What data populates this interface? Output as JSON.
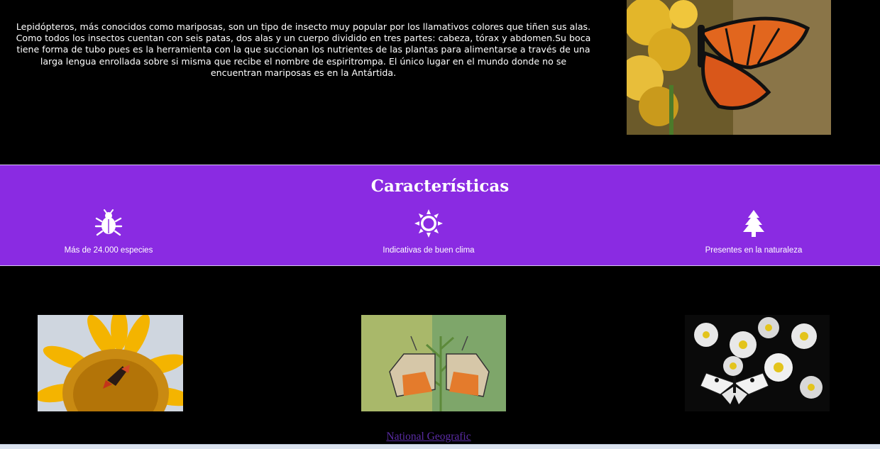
{
  "intro": {
    "text": "Lepidópteros, más conocidos como mariposas, son un tipo de insecto muy popular por los llamativos colores que tiñen sus alas. Como todos los insectos cuentan con seis patas, dos alas y un cuerpo dividido en tres partes: cabeza, tórax y abdomen.Su boca tiene forma de tubo pues es la herramienta con la que succionan los nutrientes de las plantas para alimentarse a través de una larga lengua enrollada sobre si misma que recibe el nombre de espiritrompa. El único lugar en el mundo donde no se encuentran mariposas es en la Antártida."
  },
  "features": {
    "title": "Características",
    "items": [
      {
        "icon": "bug-icon",
        "label": "Más de 24.000 especies"
      },
      {
        "icon": "sun-icon",
        "label": "Indicativas de buen clima"
      },
      {
        "icon": "tree-icon",
        "label": "Presentes en la naturaleza"
      }
    ]
  },
  "gallery": {
    "images": [
      {
        "subject": "butterfly on sunflower"
      },
      {
        "subject": "two butterflies on a stem"
      },
      {
        "subject": "butterfly on daisies"
      }
    ]
  },
  "footer": {
    "link_text": "National Geografic"
  },
  "colors": {
    "background": "#000000",
    "band": "#8a2be2",
    "link": "#5b2ca6",
    "text": "#ffffff"
  }
}
